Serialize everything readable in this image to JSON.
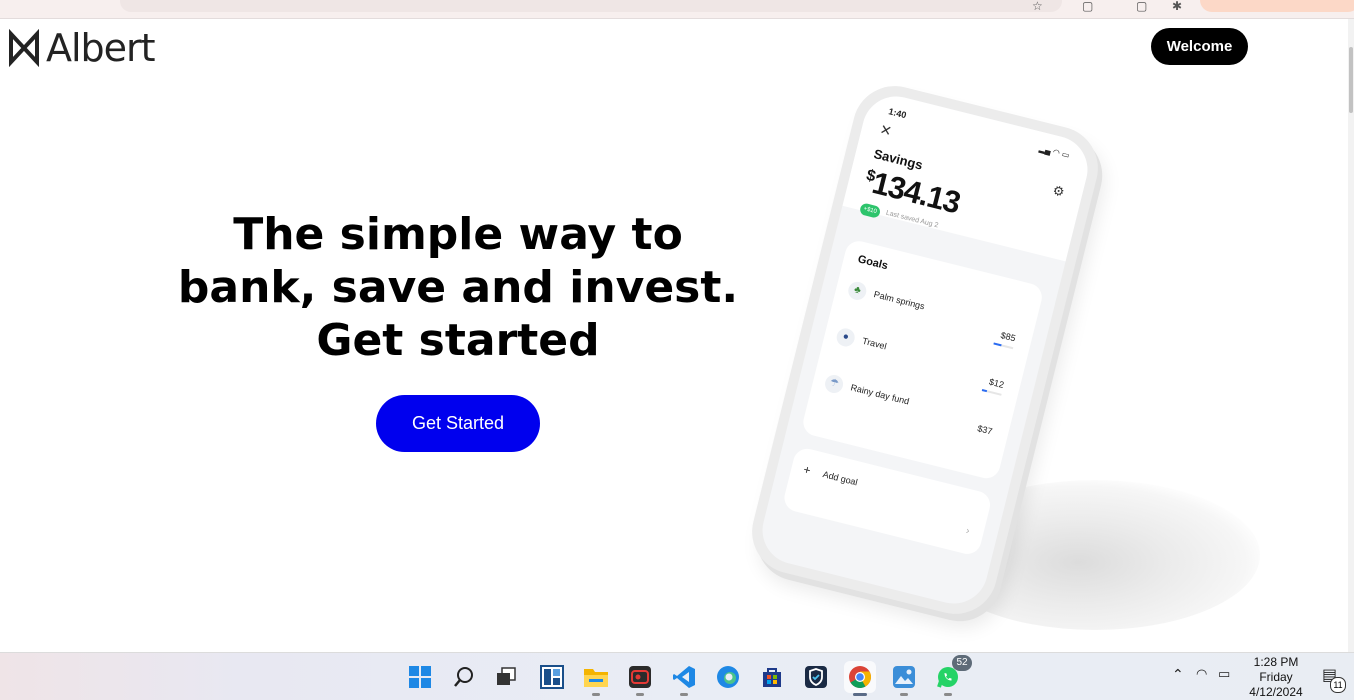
{
  "header": {
    "logo_text": "Albert",
    "welcome_label": "Welcome"
  },
  "hero": {
    "title_lines": [
      "The simple way to",
      "bank, save and invest.",
      "Get started"
    ],
    "cta_label": "Get Started"
  },
  "phone_screen": {
    "time": "1:40",
    "title": "Savings",
    "currency": "$",
    "amount": "134.13",
    "chip": "+$10",
    "last_saved": "Last saved Aug 2",
    "goals_title": "Goals",
    "goals": [
      {
        "name": "Palm springs",
        "value": "$85",
        "icon": "palm-tree-icon"
      },
      {
        "name": "Travel",
        "value": "$12",
        "icon": "globe-icon"
      },
      {
        "name": "Rainy day fund",
        "value": "$37",
        "icon": "umbrella-icon"
      }
    ],
    "add_goal": "Add goal"
  },
  "taskbar": {
    "icons": [
      "windows-start-icon",
      "search-icon",
      "task-view-icon",
      "widgets-icon",
      "file-explorer-icon",
      "video-recorder-icon",
      "vscode-icon",
      "edge-icon",
      "store-icon",
      "defender-icon",
      "chrome-icon",
      "photos-icon",
      "whatsapp-icon"
    ],
    "whatsapp_badge": "52",
    "clock": {
      "time": "1:28 PM",
      "day": "Friday",
      "date": "4/12/2024"
    },
    "notification_count": "11"
  },
  "colors": {
    "cta": "#0000ee",
    "welcome_bg": "#000000",
    "savings_chip": "#2dc46c"
  }
}
